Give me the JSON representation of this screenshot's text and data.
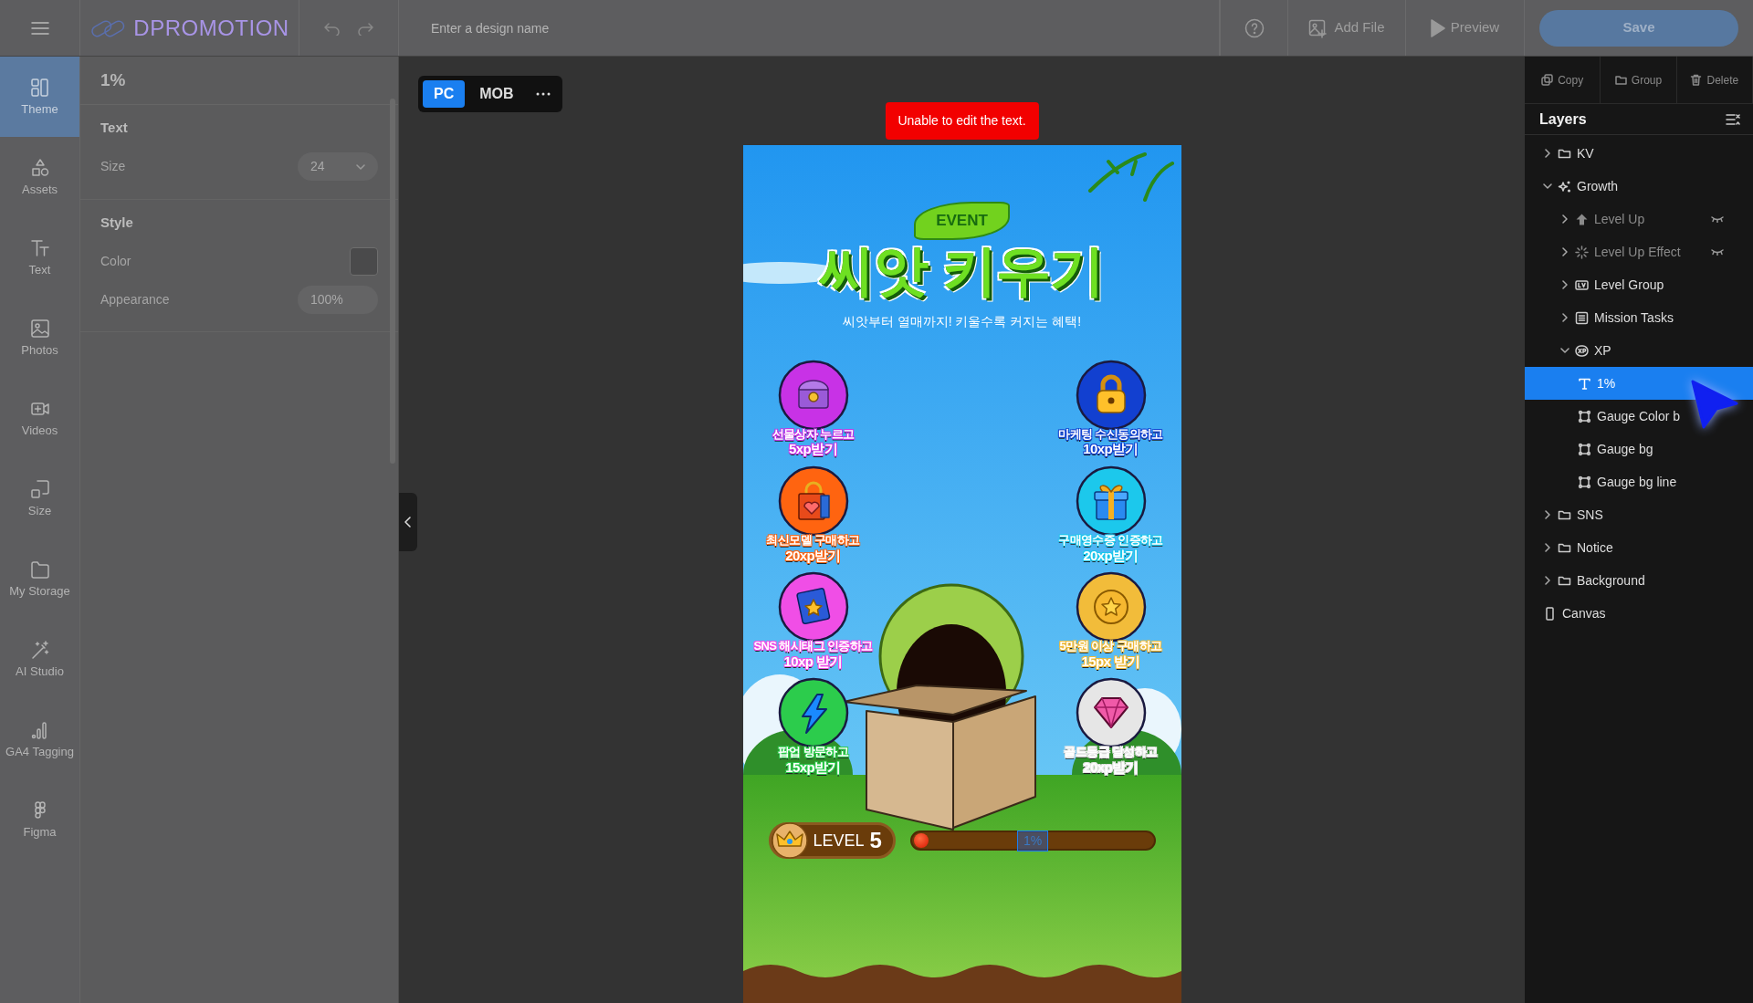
{
  "topbar": {
    "logo": "DPROMOTION",
    "design_name": {
      "placeholder": "Enter a design name"
    },
    "add_file": "Add File",
    "preview": "Preview",
    "save": "Save"
  },
  "rail": [
    {
      "label": "Theme",
      "selected": true
    },
    {
      "label": "Assets",
      "selected": false
    },
    {
      "label": "Text",
      "selected": false
    },
    {
      "label": "Photos",
      "selected": false
    },
    {
      "label": "Videos",
      "selected": false
    },
    {
      "label": "Size",
      "selected": false
    },
    {
      "label": "My Storage",
      "selected": false
    },
    {
      "label": "AI Studio",
      "selected": false
    },
    {
      "label": "GA4 Tagging",
      "selected": false
    },
    {
      "label": "Figma",
      "selected": false
    }
  ],
  "properties": {
    "title": "1%",
    "sections": [
      {
        "title": "Text",
        "fields": [
          {
            "kind": "select",
            "label": "Size",
            "value": "24"
          }
        ]
      },
      {
        "title": "Style",
        "fields": [
          {
            "kind": "color",
            "label": "Color",
            "color": "#4a4a4b"
          },
          {
            "kind": "input",
            "label": "Appearance",
            "value": "100%"
          }
        ]
      }
    ]
  },
  "canvas": {
    "devices": [
      {
        "label": "PC",
        "selected": true
      },
      {
        "label": "MOB",
        "selected": false
      }
    ],
    "toast": "Unable to edit the text."
  },
  "design": {
    "badge": "EVENT",
    "title": "씨앗 키우기",
    "subtitle": "씨앗부터 열매까지! 키울수록 커지는 혜택!",
    "missions": [
      {
        "title": "선물상자 누르고",
        "reward": "5xp받기",
        "color": "#c832e6"
      },
      {
        "title": "마케팅 수신동의하고",
        "reward": "10xp받기",
        "color": "#1240d0"
      },
      {
        "title": "최신모델 구매하고",
        "reward": "20xp받기",
        "color": "#ff6410"
      },
      {
        "title": "구매영수증 인증하고",
        "reward": "20xp받기",
        "color": "#1cc8ec"
      },
      {
        "title": "SNS 해시태그 인증하고",
        "reward": "10xp 받기",
        "color": "#f04ee6"
      },
      {
        "title": "5만원 이상 구매하고",
        "reward": "15px 받기",
        "color": "#f2bc3a"
      },
      {
        "title": "팝업 방문하고",
        "reward": "15xp받기",
        "color": "#2ccc4c"
      },
      {
        "title": "골드등급 달성하고",
        "reward": "20xp받기",
        "color": "#e6e6e6"
      }
    ],
    "level_label": "LEVEL",
    "level_value": "5",
    "gauge": {
      "level": 0.01,
      "text": "1%",
      "selected": true
    }
  },
  "layers": {
    "actions": [
      "Copy",
      "Group",
      "Delete"
    ],
    "title": "Layers",
    "items": [
      {
        "name": "KV",
        "kind": "folder",
        "expanded": false,
        "visible": true,
        "selected": false
      },
      {
        "name": "Growth",
        "kind": "sparkle",
        "expanded": true,
        "visible": true,
        "selected": false,
        "children": [
          {
            "name": "Level Up",
            "kind": "arrow",
            "expanded": false,
            "visible": false,
            "selected": false
          },
          {
            "name": "Level Up Effect",
            "kind": "spinner",
            "expanded": false,
            "visible": false,
            "selected": false
          },
          {
            "name": "Level Group",
            "kind": "level",
            "expanded": false,
            "visible": true,
            "selected": false
          },
          {
            "name": "Mission Tasks",
            "kind": "list",
            "expanded": false,
            "visible": true,
            "selected": false
          },
          {
            "name": "XP",
            "kind": "xp",
            "expanded": true,
            "visible": true,
            "selected": false,
            "children": [
              {
                "name": "1%",
                "kind": "text",
                "visible": true,
                "selected": true
              },
              {
                "name": "Gauge Color b",
                "kind": "shape",
                "visible": true,
                "selected": false
              },
              {
                "name": "Gauge bg",
                "kind": "shape",
                "visible": true,
                "selected": false
              },
              {
                "name": "Gauge bg line",
                "kind": "shape",
                "visible": true,
                "selected": false
              }
            ]
          }
        ]
      },
      {
        "name": "SNS",
        "kind": "folder",
        "expanded": false,
        "visible": true,
        "selected": false
      },
      {
        "name": "Notice",
        "kind": "folder",
        "expanded": false,
        "visible": true,
        "selected": false
      },
      {
        "name": "Background",
        "kind": "folder",
        "expanded": false,
        "visible": true,
        "selected": false
      },
      {
        "name": "Canvas",
        "kind": "canvas",
        "visible": true,
        "selected": false
      }
    ]
  }
}
